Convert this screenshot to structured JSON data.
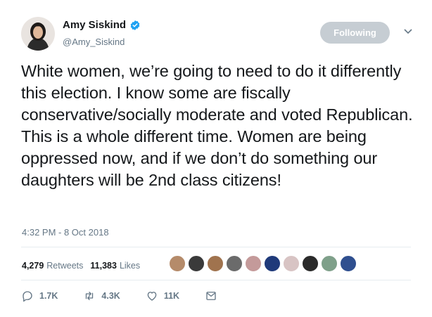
{
  "author": {
    "name": "Amy Siskind",
    "handle": "@Amy_Siskind",
    "verified": true
  },
  "follow_button_label": "Following",
  "tweet_text": "White women, we’re going to need to do it differently this election. I know some are fiscally conservative/socially moderate and voted Republican. This is a whole different time. Women are being oppressed now, and if we don’t do something our daughters will be 2nd class citizens!",
  "timestamp": "4:32 PM - 8 Oct 2018",
  "stats": {
    "retweets_count": "4,279",
    "retweets_label": "Retweets",
    "likes_count": "11,383",
    "likes_label": "Likes"
  },
  "likers_colors": [
    "#b58b6a",
    "#3a3a3a",
    "#a0734e",
    "#6b6b6b",
    "#c49a9a",
    "#1f3a7a",
    "#d8c4c4",
    "#2a2a2a",
    "#7fa08a",
    "#2f4f8f"
  ],
  "actions": {
    "reply_count": "1.7K",
    "retweet_count": "4.3K",
    "like_count": "11K"
  },
  "colors": {
    "verified": "#1da1f2",
    "muted_text": "#657786",
    "follow_button": "#c6cdd3"
  }
}
